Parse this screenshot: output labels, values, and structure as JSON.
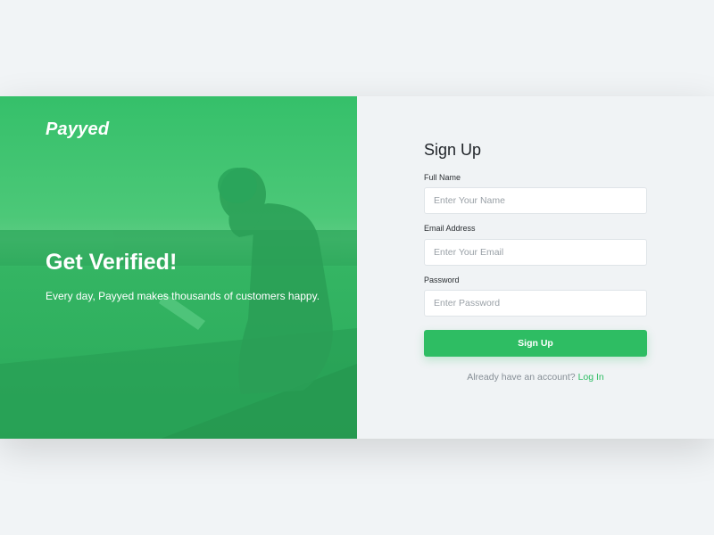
{
  "brand": {
    "name": "Payyed"
  },
  "hero": {
    "title": "Get Verified!",
    "subtitle": "Every day, Payyed makes thousands of customers happy."
  },
  "form": {
    "title": "Sign Up",
    "fields": [
      {
        "label": "Full Name",
        "placeholder": "Enter Your Name",
        "value": ""
      },
      {
        "label": "Email Address",
        "placeholder": "Enter Your Email",
        "value": ""
      },
      {
        "label": "Password",
        "placeholder": "Enter Password",
        "value": ""
      }
    ],
    "submit_label": "Sign Up",
    "login_prompt": "Already have an account?",
    "login_link": "Log In"
  },
  "colors": {
    "brand_green": "#2ebd63",
    "panel_background": "#f0f3f5",
    "page_background": "#f1f4f6"
  }
}
